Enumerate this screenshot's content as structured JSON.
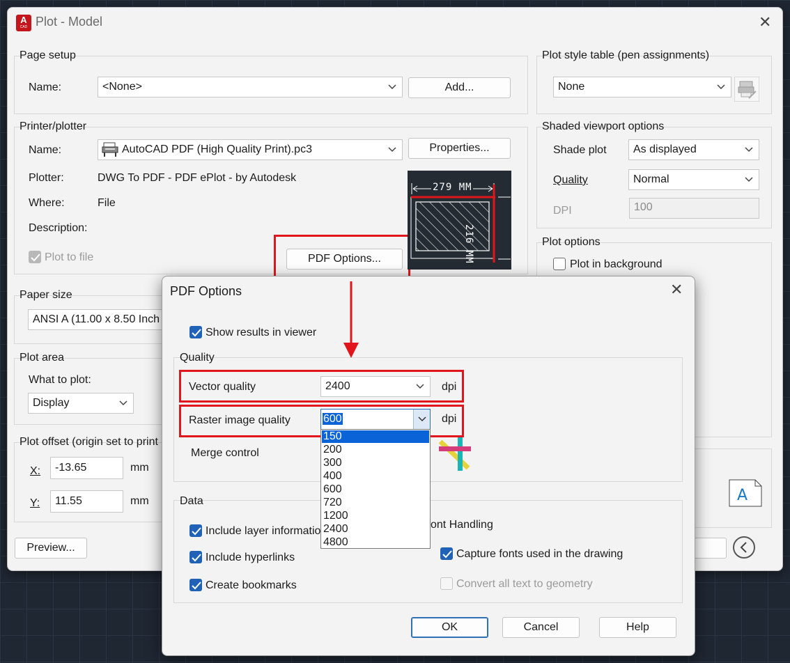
{
  "window": {
    "title": "Plot - Model",
    "app_icon_letter": "A",
    "app_icon_sub": "CAD"
  },
  "page_setup": {
    "group_label": "Page setup",
    "name_label": "Name:",
    "name_value": "<None>",
    "add_button": "Add..."
  },
  "printer": {
    "group_label": "Printer/plotter",
    "name_label": "Name:",
    "name_value": "AutoCAD PDF (High Quality Print).pc3",
    "properties_button": "Properties...",
    "plotter_label": "Plotter:",
    "plotter_value": "DWG To PDF - PDF ePlot - by Autodesk",
    "where_label": "Where:",
    "where_value": "File",
    "description_label": "Description:",
    "plot_to_file_label": "Plot to file",
    "pdf_options_button": "PDF Options..."
  },
  "preview": {
    "width_label": "279 MM",
    "height_label": "216 MM"
  },
  "paper_size": {
    "group_label": "Paper size",
    "value": "ANSI A (11.00 x 8.50 Inch"
  },
  "plot_area": {
    "group_label": "Plot area",
    "what_label": "What to plot:",
    "what_value": "Display"
  },
  "plot_offset": {
    "group_label": "Plot offset (origin set to print",
    "x_label": "X:",
    "x_value": "-13.65",
    "y_label": "Y:",
    "y_value": "11.55",
    "unit": "mm"
  },
  "preview_button": "Preview...",
  "plot_style": {
    "group_label": "Plot style table (pen assignments)",
    "value": "None"
  },
  "shaded_viewport": {
    "group_label": "Shaded viewport options",
    "shade_label": "Shade plot",
    "shade_value": "As displayed",
    "quality_label": "Quality",
    "quality_value": "Normal",
    "dpi_label": "DPI",
    "dpi_value": "100"
  },
  "plot_options": {
    "group_label": "Plot options",
    "background_label": "Plot in background"
  },
  "pdf_options": {
    "title": "PDF Options",
    "show_results_label": "Show results in viewer",
    "quality_group": "Quality",
    "vector_label": "Vector quality",
    "vector_value": "2400",
    "raster_label": "Raster image quality",
    "raster_value": "600",
    "dpi_unit": "dpi",
    "merge_label": "Merge control",
    "raster_options": [
      "150",
      "200",
      "300",
      "400",
      "600",
      "720",
      "1200",
      "2400",
      "4800"
    ],
    "data_group": "Data",
    "layer_info_label": "Include layer informatio",
    "hyperlinks_label": "Include hyperlinks",
    "bookmarks_label": "Create bookmarks",
    "font_handling_label": "ont Handling",
    "capture_fonts_label": "Capture fonts used in the drawing",
    "convert_text_label": "Convert all text to geometry",
    "ok_button": "OK",
    "cancel_button": "Cancel",
    "help_button": "Help"
  },
  "colors": {
    "annotation_red": "#e0161c",
    "checkbox_blue": "#1f62b8",
    "selection_blue": "#0a64d8"
  }
}
